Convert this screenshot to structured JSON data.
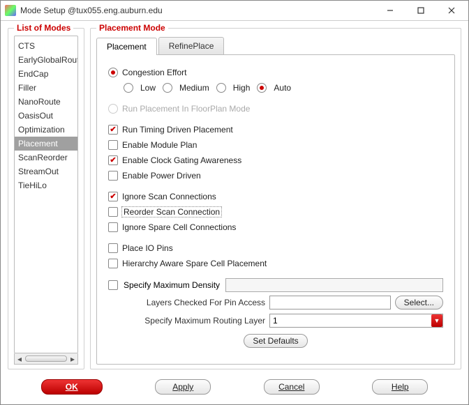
{
  "window": {
    "title": "Mode Setup @tux055.eng.auburn.edu"
  },
  "left": {
    "legend": "List of Modes",
    "items": [
      "CTS",
      "EarlyGlobalRoute",
      "EndCap",
      "Filler",
      "NanoRoute",
      "OasisOut",
      "Optimization",
      "Placement",
      "ScanReorder",
      "StreamOut",
      "TieHiLo"
    ],
    "selected": "Placement"
  },
  "right": {
    "legend": "Placement Mode",
    "tabs": {
      "placement": "Placement",
      "refine": "RefinePlace",
      "active": "placement"
    },
    "congestion": {
      "label": "Congestion Effort",
      "options": {
        "low": "Low",
        "medium": "Medium",
        "high": "High",
        "auto": "Auto"
      },
      "value": "auto"
    },
    "floorplan": {
      "label": "Run Placement In FloorPlan Mode",
      "checked": false,
      "disabled": true
    },
    "timing": {
      "label": "Run Timing Driven Placement",
      "checked": true
    },
    "module": {
      "label": "Enable Module Plan",
      "checked": false
    },
    "clockgate": {
      "label": "Enable Clock Gating Awareness",
      "checked": true
    },
    "power": {
      "label": "Enable Power Driven",
      "checked": false
    },
    "ignorescan": {
      "label": "Ignore Scan Connections",
      "checked": true
    },
    "reorderscan": {
      "label": "Reorder Scan Connection",
      "checked": false,
      "highlight": true
    },
    "ignorespare": {
      "label": "Ignore Spare Cell Connections",
      "checked": false
    },
    "ioPins": {
      "label": "Place IO Pins",
      "checked": false
    },
    "hierSpare": {
      "label": "Hierarchy Aware Spare Cell Placement",
      "checked": false
    },
    "maxDensity": {
      "label": "Specify Maximum Density",
      "checked": false,
      "value": ""
    },
    "layersChecked": {
      "label": "Layers Checked For Pin Access",
      "value": "",
      "selectBtn": "Select..."
    },
    "maxRoutingLayer": {
      "label": "Specify Maximum Routing Layer",
      "value": "1"
    },
    "setDefaultsBtn": "Set Defaults"
  },
  "footer": {
    "ok": "OK",
    "apply": "Apply",
    "cancel": "Cancel",
    "help": "Help"
  }
}
